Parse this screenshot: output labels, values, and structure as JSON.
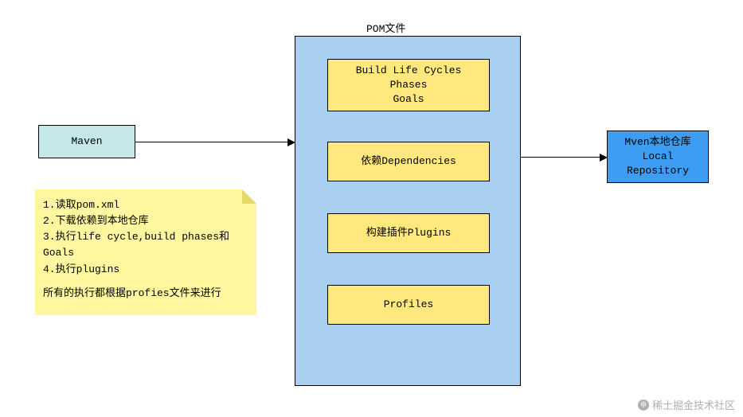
{
  "maven": {
    "label": "Maven"
  },
  "pom": {
    "title": "POM文件",
    "buildLifeCycles": {
      "line1": "Build Life Cycles",
      "line2": "Phases",
      "line3": "Goals"
    },
    "dependencies": {
      "label": "依赖Dependencies"
    },
    "plugins": {
      "label": "构建插件Plugins"
    },
    "profiles": {
      "label": "Profiles"
    }
  },
  "repo": {
    "line1": "Mven本地仓库",
    "line2": "Local",
    "line3": "Repository"
  },
  "note": {
    "line1": "1.读取pom.xml",
    "line2": "2.下载依赖到本地仓库",
    "line3": "3.执行life cycle,build phases和Goals",
    "line4": "4.执行plugins",
    "summary": "所有的执行都根据profies文件来进行"
  },
  "watermark": "稀土掘金技术社区"
}
